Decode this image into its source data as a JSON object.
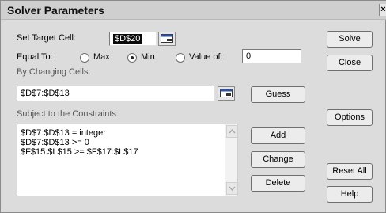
{
  "dialog": {
    "title": "Solver Parameters",
    "close_label": "×"
  },
  "target": {
    "label": "Set Target Cell:",
    "value": "$D$20",
    "collapse_icon": "range-select-icon"
  },
  "equal_to": {
    "label": "Equal To:",
    "options": [
      "Max",
      "Min",
      "Value of:"
    ],
    "selected": "Min",
    "value": "0"
  },
  "changing": {
    "label": "By Changing Cells:",
    "value": "$D$7:$D$13",
    "collapse_icon": "range-select-icon"
  },
  "constraints": {
    "label": "Subject to the Constraints:",
    "items": [
      "$D$7:$D$13 = integer",
      "$D$7:$D$13 >= 0",
      "$F$15:$L$15 >= $F$17:$L$17"
    ]
  },
  "buttons": {
    "solve": "Solve",
    "close": "Close",
    "guess": "Guess",
    "options": "Options",
    "add": "Add",
    "change": "Change",
    "delete": "Delete",
    "reset_all": "Reset All",
    "help": "Help"
  }
}
